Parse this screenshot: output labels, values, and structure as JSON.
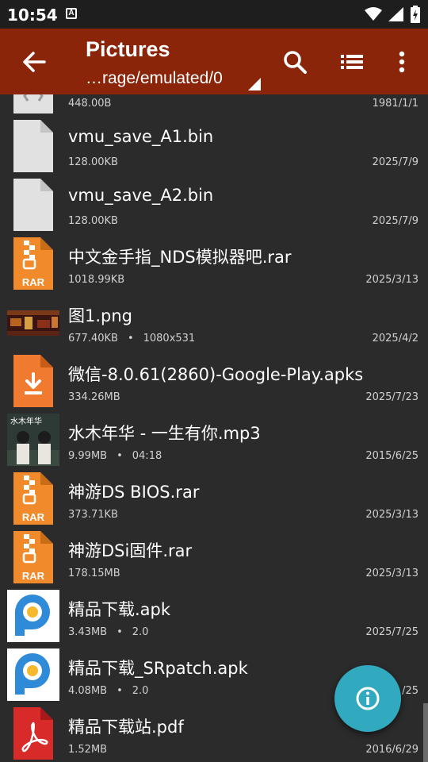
{
  "status_bar": {
    "time": "10:54",
    "notification_letter": "A"
  },
  "app_bar": {
    "title": "Pictures",
    "path": "…rage/emulated/0"
  },
  "files": [
    {
      "name": "",
      "size": "448.00B",
      "extra": "",
      "date": "1981/1/1",
      "icon": "generic-file"
    },
    {
      "name": "vmu_save_A1.bin",
      "size": "128.00KB",
      "extra": "",
      "date": "2025/7/9",
      "icon": "generic-file"
    },
    {
      "name": "vmu_save_A2.bin",
      "size": "128.00KB",
      "extra": "",
      "date": "2025/7/9",
      "icon": "generic-file"
    },
    {
      "name": "中文金手指_NDS模拟器吧.rar",
      "size": "1018.99KB",
      "extra": "",
      "date": "2025/3/13",
      "icon": "rar"
    },
    {
      "name": "图1.png",
      "size": "677.40KB",
      "extra": "1080x531",
      "date": "2025/4/2",
      "icon": "image-thumbnail"
    },
    {
      "name": "微信-8.0.61(2860)-Google-Play.apks",
      "size": "334.26MB",
      "extra": "",
      "date": "2025/7/23",
      "icon": "apks"
    },
    {
      "name": "水木年华 - 一生有你.mp3",
      "size": "9.99MB",
      "extra": "04:18",
      "date": "2015/6/25",
      "icon": "album-art"
    },
    {
      "name": "神游DS BIOS.rar",
      "size": "373.71KB",
      "extra": "",
      "date": "2025/3/13",
      "icon": "rar"
    },
    {
      "name": "神游DSi固件.rar",
      "size": "178.15MB",
      "extra": "",
      "date": "2025/3/13",
      "icon": "rar"
    },
    {
      "name": "精品下载.apk",
      "size": "3.43MB",
      "extra": "2.0",
      "date": "2025/7/25",
      "icon": "app"
    },
    {
      "name": "精品下载_SRpatch.apk",
      "size": "4.08MB",
      "extra": "2.0",
      "date": "/25",
      "icon": "app"
    },
    {
      "name": "精品下载站.pdf",
      "size": "1.52MB",
      "extra": "",
      "date": "2016/6/29",
      "icon": "pdf"
    }
  ],
  "colors": {
    "app_bar": "#8a2509",
    "list_bg": "#2b2b2b",
    "fab": "#31a9bf",
    "rar": "#f08a2a",
    "pdf": "#d92a2a"
  }
}
